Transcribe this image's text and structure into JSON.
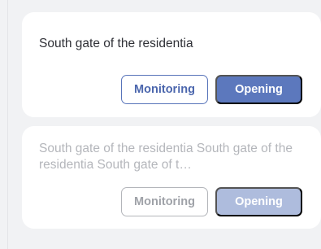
{
  "cards": [
    {
      "text": "South gate of the residentia",
      "monitoring_label": "Monitoring",
      "opening_label": "Opening",
      "state": "enabled"
    },
    {
      "text": "South gate of the residentia South gate of the residentia South gate of t…",
      "monitoring_label": "Monitoring",
      "opening_label": "Opening",
      "state": "disabled"
    }
  ],
  "colors": {
    "background": "#f1f2f4",
    "card": "#ffffff",
    "accent": "#5c78bd",
    "accent_disabled": "#aebcdd",
    "text": "#2f3036",
    "text_disabled": "#b4b6bb"
  }
}
